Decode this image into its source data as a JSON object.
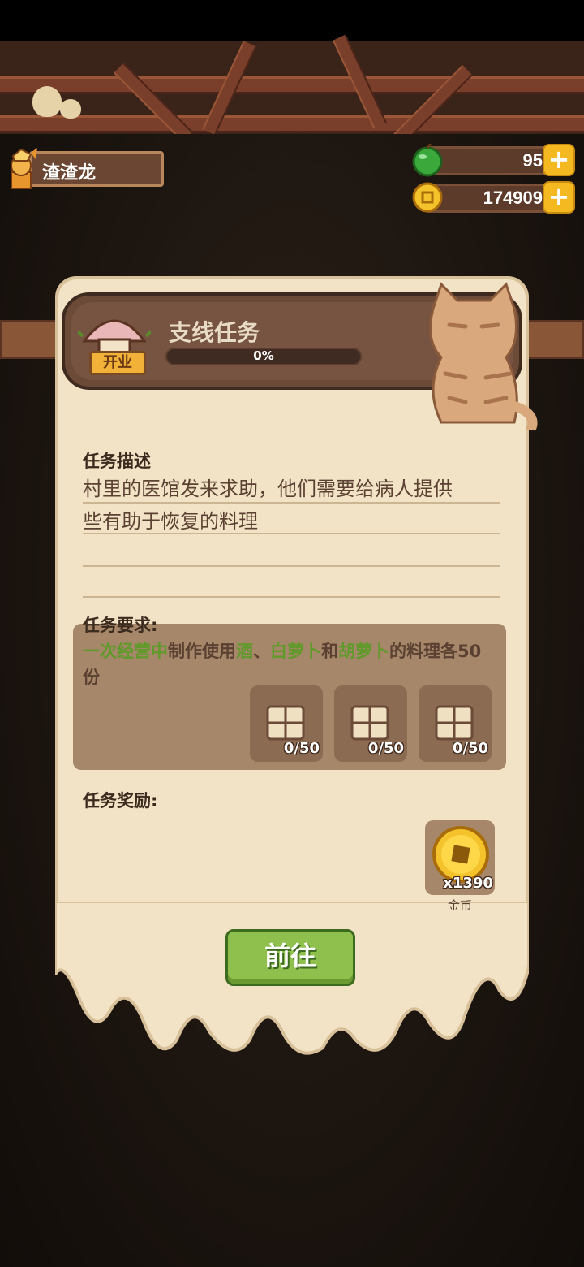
{
  "player": {
    "name": "渣渣龙"
  },
  "resources": {
    "gems": {
      "value": "95",
      "icon": "green-gem-icon"
    },
    "coins": {
      "value": "174909",
      "icon": "coin-icon"
    }
  },
  "quest": {
    "badge": "开业",
    "title": "支线任务",
    "progress_text": "0%",
    "progress": 0,
    "description_label": "任务描述",
    "description_lines": [
      "村里的医馆发来求助，他们需要给病人提供",
      "些有助于恢复的料理"
    ],
    "requirement_label": "任务要求:",
    "requirement": {
      "part1": "一次经营中",
      "part2": "制作使用",
      "part3": "酒",
      "part4": "、",
      "part5": "白萝卜",
      "part6": "和",
      "part7": "胡萝卜",
      "part8": "的料理各50份"
    },
    "requirement_items": [
      {
        "count": "0/50",
        "icon": "recipe-scroll-icon"
      },
      {
        "count": "0/50",
        "icon": "recipe-scroll-icon"
      },
      {
        "count": "0/50",
        "icon": "recipe-scroll-icon"
      }
    ],
    "reward_label": "任务奖励:",
    "reward": {
      "count": "x1390",
      "name": "金币",
      "icon": "gold-coin-icon"
    },
    "go_button": "前往"
  },
  "colors": {
    "accent_green": "#5f9a2a",
    "button_green": "#8fc04e",
    "parchment": "#f2e3c6",
    "wood": "#6b4a38",
    "gold": "#f4b920"
  }
}
